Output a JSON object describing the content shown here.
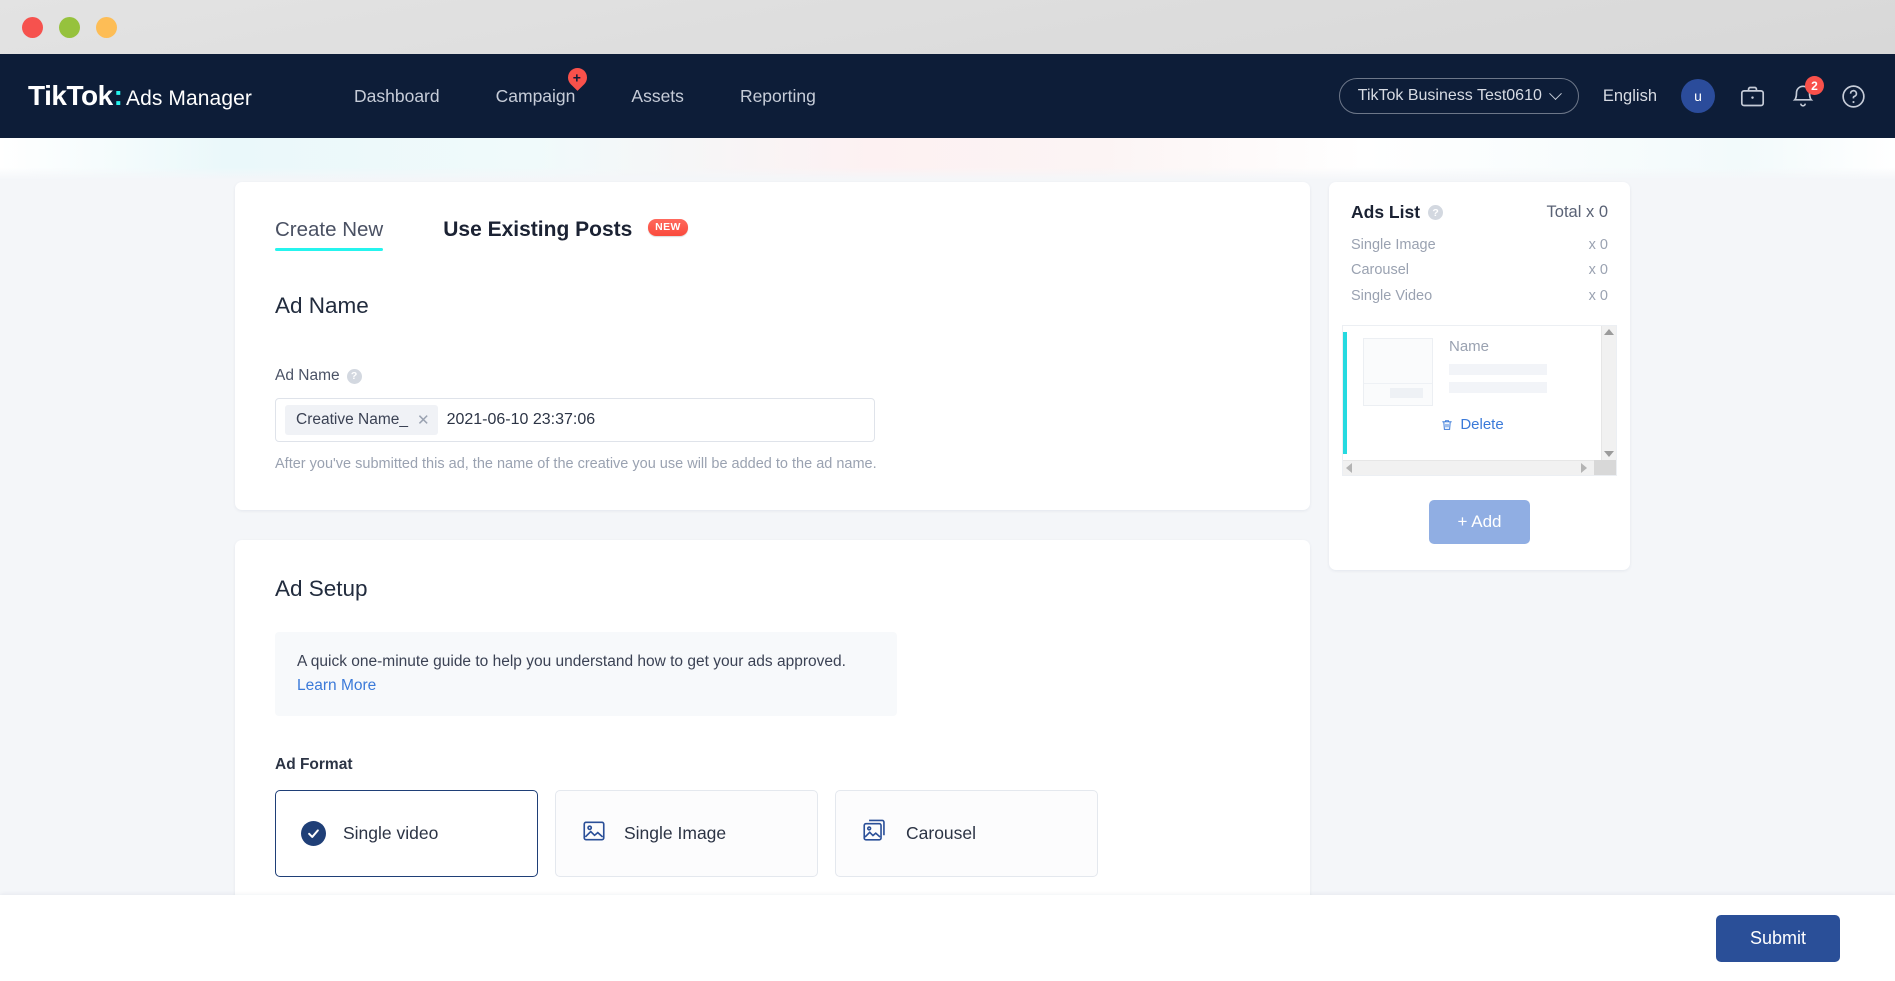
{
  "window": {
    "traffic_lights": [
      "close",
      "maximize",
      "minimize"
    ]
  },
  "navbar": {
    "brand_primary": "TikTok",
    "brand_colon": ":",
    "brand_secondary": "Ads Manager",
    "links": [
      {
        "label": "Dashboard",
        "badge": null
      },
      {
        "label": "Campaign",
        "badge": "+"
      },
      {
        "label": "Assets",
        "badge": null
      },
      {
        "label": "Reporting",
        "badge": null
      }
    ],
    "account": "TikTok Business Test0610",
    "language": "English",
    "avatar_initial": "u",
    "notification_count": "2",
    "icons": [
      "briefcase-icon",
      "bell-icon",
      "help-icon"
    ]
  },
  "tabs": [
    {
      "label": "Create New",
      "active": true,
      "badge": null
    },
    {
      "label": "Use Existing Posts",
      "active": false,
      "badge": "NEW"
    }
  ],
  "ad_name_section": {
    "title": "Ad Name",
    "field_label": "Ad Name",
    "help": "?",
    "chip": "Creative Name_",
    "value": "2021-06-10 23:37:06",
    "hint": "After you've submitted this ad, the name of the creative you use will be added to the ad name."
  },
  "ad_setup_section": {
    "title": "Ad Setup",
    "notice_text": "A quick one-minute guide to help you understand how to get your ads approved. ",
    "notice_link": "Learn More",
    "format_label": "Ad Format",
    "formats": [
      {
        "label": "Single video",
        "icon": "check-circle-icon",
        "selected": true
      },
      {
        "label": "Single Image",
        "icon": "single-image-icon",
        "selected": false
      },
      {
        "label": "Carousel",
        "icon": "carousel-icon",
        "selected": false
      }
    ]
  },
  "ads_list": {
    "title": "Ads List",
    "help": "?",
    "total": "Total x 0",
    "counts": [
      {
        "label": "Single Image",
        "value": "x 0"
      },
      {
        "label": "Carousel",
        "value": "x 0"
      },
      {
        "label": "Single Video",
        "value": "x 0"
      }
    ],
    "item": {
      "name_placeholder": "Name",
      "delete_label": "Delete"
    },
    "add_label": "+ Add"
  },
  "footer": {
    "submit_label": "Submit"
  },
  "colors": {
    "navy": "#0d1d38",
    "brand_cyan": "#25f4ee",
    "badge_red": "#f9514b",
    "submit_blue": "#2a4f98",
    "add_blue": "#90aee3",
    "link_blue": "#3b7ad9",
    "page_bg": "#f4f6f9"
  }
}
